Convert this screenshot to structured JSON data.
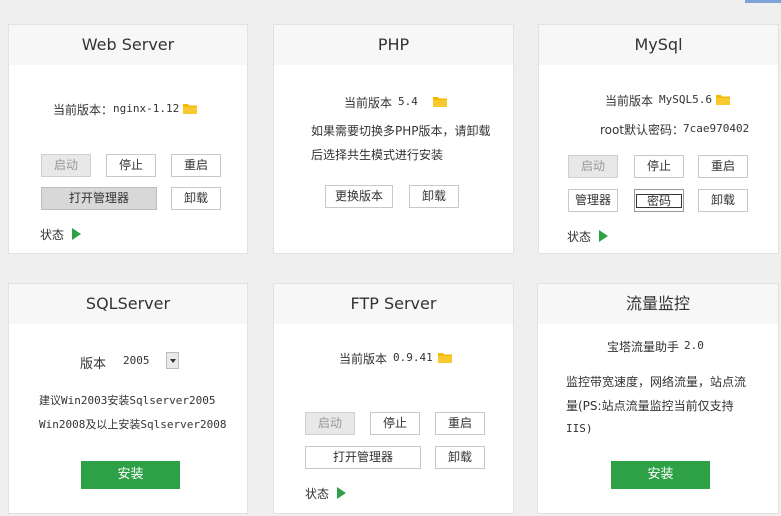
{
  "cards": {
    "web": {
      "title": "Web Server",
      "version_label": "当前版本：",
      "version_value": "nginx-1.12",
      "start": "启动",
      "stop": "停止",
      "restart": "重启",
      "open_manager": "打开管理器",
      "uninstall": "卸载",
      "status": "状态"
    },
    "php": {
      "title": "PHP",
      "version_label": "当前版本",
      "version_value": "5.4",
      "tip_line1": "如果需要切换多PHP版本，请卸载",
      "tip_line2": "后选择共生模式进行安装",
      "change_version": "更换版本",
      "uninstall": "卸载"
    },
    "mysql": {
      "title": "MySql",
      "version_label": "当前版本",
      "version_value": "MySQL5.6",
      "root_label": "root默认密码：",
      "root_value": "7cae970402",
      "start": "启动",
      "stop": "停止",
      "restart": "重启",
      "manager": "管理器",
      "password": "密码",
      "uninstall": "卸载",
      "status": "状态"
    },
    "sqlserver": {
      "title": "SQLServer",
      "version_label": "版本",
      "version_selected": "2005",
      "tip_line1": "建议Win2003安装Sqlserver2005",
      "tip_line2": "Win2008及以上安装Sqlserver2008",
      "install": "安装"
    },
    "ftp": {
      "title": "FTP Server",
      "version_label": "当前版本",
      "version_value": "0.9.41",
      "start": "启动",
      "stop": "停止",
      "restart": "重启",
      "open_manager": "打开管理器",
      "uninstall": "卸载",
      "status": "状态"
    },
    "traffic": {
      "title": "流量监控",
      "app_name": "宝塔流量助手",
      "app_version": "2.0",
      "desc_line1": "监控带宽速度，网络流量，站点流",
      "desc_line2": "量(PS:站点流量监控当前仅支持",
      "desc_line3": "IIS)",
      "install": "安装"
    }
  },
  "colors": {
    "accent_green": "#2ea146",
    "folder_yellow": "#f5b800",
    "header_bg": "#f7f7f7"
  },
  "icons": [
    "folder-icon",
    "status-play-icon",
    "dropdown-arrow-icon"
  ]
}
